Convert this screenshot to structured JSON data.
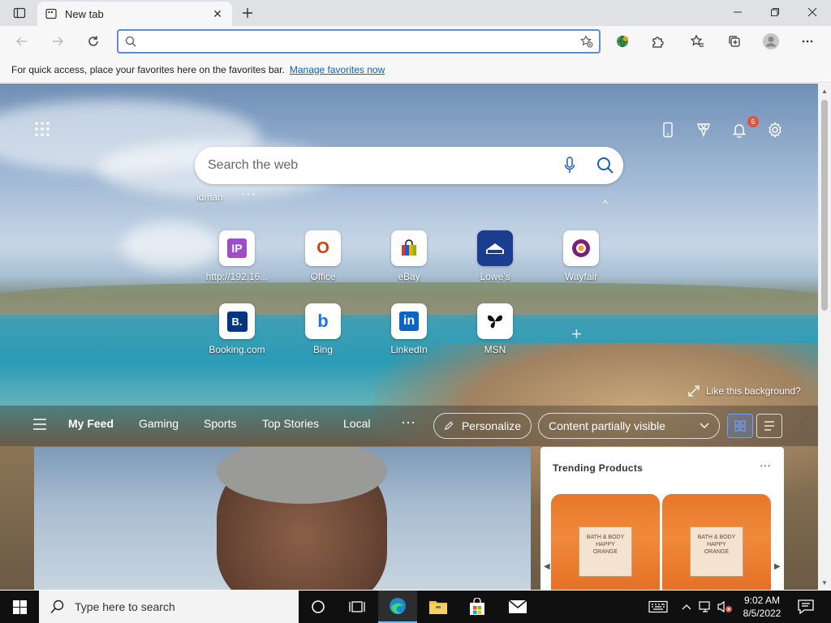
{
  "browser": {
    "tab_title": "New tab",
    "tab_close": "✕",
    "address_value": "",
    "favbar_text": "For quick access, place your favorites here on the favorites bar.",
    "favbar_link": "Manage favorites now"
  },
  "ntp": {
    "search_placeholder": "Search the web",
    "notification_count": "6",
    "account_name": "idman",
    "more": "···",
    "caret": "^",
    "add": "+",
    "tiles": [
      {
        "label": "http://192.16...",
        "glyph": "IP",
        "bg": "#9f4fc6",
        "fg": "#ffffff"
      },
      {
        "label": "Office",
        "glyph": "O",
        "bg": "#ffffff",
        "fg": "#d83b01"
      },
      {
        "label": "eBay",
        "glyph": "▮",
        "bg": "#ffffff",
        "fg": "#111111"
      },
      {
        "label": "Lowe's",
        "glyph": "▬",
        "bg": "#1b3d8f",
        "fg": "#ffffff"
      },
      {
        "label": "Wayfair",
        "glyph": "◉",
        "bg": "#ffffff",
        "fg": "#7b1e7a"
      },
      {
        "label": "Booking.com",
        "glyph": "B.",
        "bg": "#003580",
        "fg": "#ffffff"
      },
      {
        "label": "Bing",
        "glyph": "b",
        "bg": "#ffffff",
        "fg": "#1a73e8"
      },
      {
        "label": "LinkedIn",
        "glyph": "in",
        "bg": "#0a66c2",
        "fg": "#ffffff"
      },
      {
        "label": "MSN",
        "glyph": "✦",
        "bg": "#ffffff",
        "fg": "#111111"
      }
    ],
    "like_bg": "Like this background?",
    "feed": {
      "tabs": [
        "My Feed",
        "Gaming",
        "Sports",
        "Top Stories",
        "Local"
      ],
      "more": "···",
      "personalize": "Personalize",
      "content_visibility": "Content partially visible"
    },
    "trending": {
      "title": "Trending Products",
      "more": "···",
      "products": [
        {
          "label": "BATH & BODY\nHAPPY\nORANGE"
        },
        {
          "label": "BATH & BODY\nHAPPY\nORANGE"
        }
      ]
    }
  },
  "taskbar": {
    "search_placeholder": "Type here to search",
    "time": "9:02 AM",
    "date": "8/5/2022"
  },
  "colors": {
    "accent": "#0a62bd",
    "taskbar": "#101010",
    "badge": "#e0533a"
  }
}
